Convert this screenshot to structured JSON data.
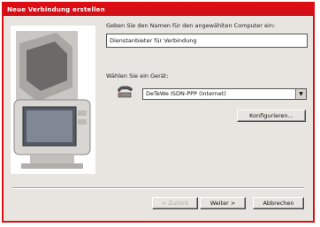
{
  "window": {
    "title": "Neue Verbindung erstellen"
  },
  "instruction": "Geben Sie den Namen für den angewählten Computer ein:",
  "connection_name": {
    "value": "Dienstanbieter für Verbindung"
  },
  "device_label": "Wählen Sie ein Gerät:",
  "device_select": {
    "value": "DeTeWe ISDN-PPP (Internet)"
  },
  "buttons": {
    "configure": "Konfigurieren...",
    "back": "< Zurück",
    "next": "Weiter >",
    "cancel": "Abbrechen"
  },
  "colors": {
    "frame": "#d90f12",
    "titlebar": "#e00b14",
    "dialog_bg": "#e8e4e0"
  },
  "icons": {
    "illustration": "computer-monitor-illustration",
    "device": "modem-phone-icon"
  }
}
